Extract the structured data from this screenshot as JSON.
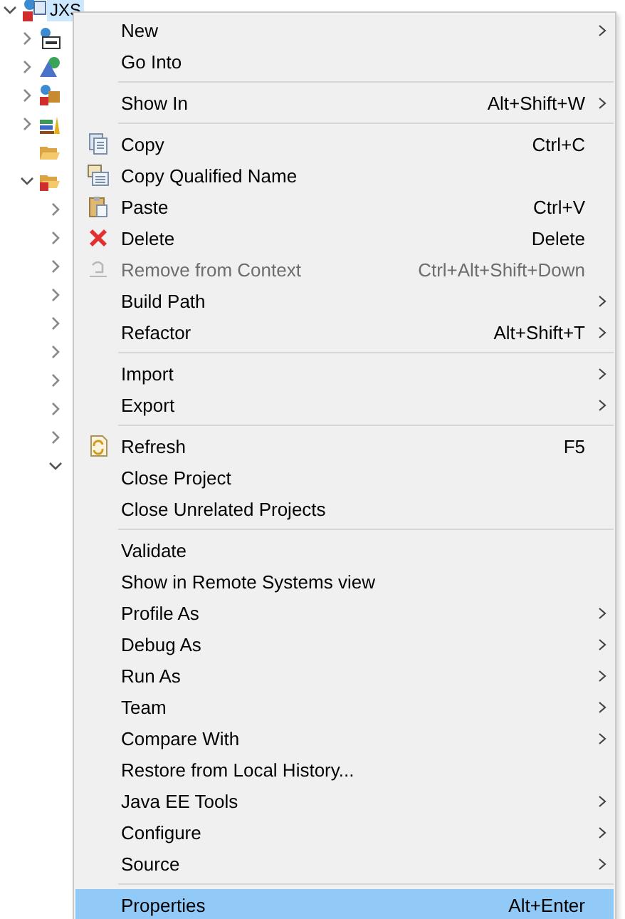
{
  "tree": {
    "label": "JXS",
    "selected": true,
    "expanded": true,
    "kind": "web-project",
    "children": [
      {
        "kind": "web-module",
        "expanded": false
      },
      {
        "kind": "jpa",
        "expanded": false
      },
      {
        "kind": "ear-project",
        "expanded": false
      },
      {
        "kind": "library",
        "expanded": false
      },
      {
        "kind": "folder"
      },
      {
        "kind": "error-folder",
        "expanded": true,
        "children": [
          {
            "expanded": false
          },
          {
            "expanded": false
          },
          {
            "expanded": false
          },
          {
            "expanded": false
          },
          {
            "expanded": false
          },
          {
            "expanded": false
          },
          {
            "expanded": false
          },
          {
            "expanded": false
          },
          {
            "expanded": false
          },
          {
            "expanded": true
          }
        ]
      }
    ]
  },
  "context_menu": [
    {
      "kind": "item",
      "label": "New",
      "submenu": true,
      "disabled": false,
      "selected": false
    },
    {
      "kind": "item",
      "label": "Go Into",
      "submenu": false,
      "disabled": false,
      "selected": false
    },
    {
      "kind": "separator"
    },
    {
      "kind": "item",
      "label": "Show In",
      "shortcut": "Alt+Shift+W",
      "submenu": true,
      "disabled": false,
      "selected": false
    },
    {
      "kind": "separator"
    },
    {
      "kind": "copy",
      "label": "Copy",
      "shortcut": "Ctrl+C",
      "submenu": false,
      "disabled": false,
      "selected": false
    },
    {
      "kind": "copy-name",
      "label": "Copy Qualified Name",
      "submenu": false,
      "disabled": false,
      "selected": false
    },
    {
      "kind": "paste",
      "label": "Paste",
      "shortcut": "Ctrl+V",
      "submenu": false,
      "disabled": false,
      "selected": false
    },
    {
      "kind": "delete",
      "label": "Delete",
      "shortcut": "Delete",
      "submenu": false,
      "disabled": false,
      "selected": false
    },
    {
      "kind": "remove",
      "label": "Remove from Context",
      "shortcut": "Ctrl+Alt+Shift+Down",
      "submenu": false,
      "disabled": true,
      "selected": false
    },
    {
      "kind": "item",
      "label": "Build Path",
      "submenu": true,
      "disabled": false,
      "selected": false
    },
    {
      "kind": "item",
      "label": "Refactor",
      "shortcut": "Alt+Shift+T",
      "submenu": true,
      "disabled": false,
      "selected": false
    },
    {
      "kind": "separator"
    },
    {
      "kind": "item",
      "label": "Import",
      "submenu": true,
      "disabled": false,
      "selected": false
    },
    {
      "kind": "item",
      "label": "Export",
      "submenu": true,
      "disabled": false,
      "selected": false
    },
    {
      "kind": "separator"
    },
    {
      "kind": "refresh",
      "label": "Refresh",
      "shortcut": "F5",
      "submenu": false,
      "disabled": false,
      "selected": false
    },
    {
      "kind": "item",
      "label": "Close Project",
      "submenu": false,
      "disabled": false,
      "selected": false
    },
    {
      "kind": "item",
      "label": "Close Unrelated Projects",
      "submenu": false,
      "disabled": false,
      "selected": false
    },
    {
      "kind": "separator"
    },
    {
      "kind": "item",
      "label": "Validate",
      "submenu": false,
      "disabled": false,
      "selected": false
    },
    {
      "kind": "item",
      "label": "Show in Remote Systems view",
      "submenu": false,
      "disabled": false,
      "selected": false
    },
    {
      "kind": "item",
      "label": "Profile As",
      "submenu": true,
      "disabled": false,
      "selected": false
    },
    {
      "kind": "item",
      "label": "Debug As",
      "submenu": true,
      "disabled": false,
      "selected": false
    },
    {
      "kind": "item",
      "label": "Run As",
      "submenu": true,
      "disabled": false,
      "selected": false
    },
    {
      "kind": "item",
      "label": "Team",
      "submenu": true,
      "disabled": false,
      "selected": false
    },
    {
      "kind": "item",
      "label": "Compare With",
      "submenu": true,
      "disabled": false,
      "selected": false
    },
    {
      "kind": "item",
      "label": "Restore from Local History...",
      "submenu": false,
      "disabled": false,
      "selected": false
    },
    {
      "kind": "item",
      "label": "Java EE Tools",
      "submenu": true,
      "disabled": false,
      "selected": false
    },
    {
      "kind": "item",
      "label": "Configure",
      "submenu": true,
      "disabled": false,
      "selected": false
    },
    {
      "kind": "item",
      "label": "Source",
      "submenu": true,
      "disabled": false,
      "selected": false
    },
    {
      "kind": "separator"
    },
    {
      "kind": "item",
      "label": "Properties",
      "shortcut": "Alt+Enter",
      "submenu": false,
      "disabled": false,
      "selected": true
    }
  ]
}
